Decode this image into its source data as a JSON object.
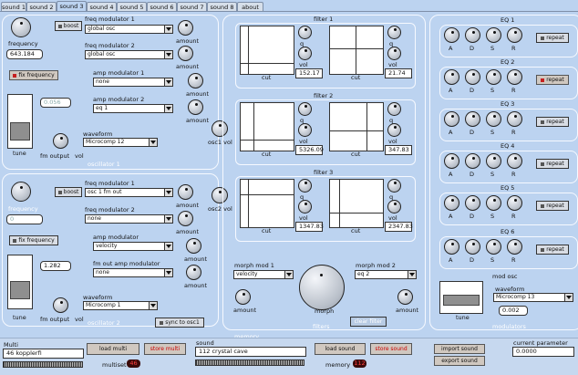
{
  "tabs": [
    "sound 1",
    "sound 2",
    "sound 3",
    "sound 4",
    "sound 5",
    "sound 6",
    "sound 7",
    "sound 8",
    "about"
  ],
  "osc1": {
    "frequency_label": "frequency",
    "frequency_value": "643.184",
    "boost": "boost",
    "fix_frequency": "fix frequency",
    "fix_value": "0.056",
    "freq_mod1_label": "freq modulator 1",
    "freq_mod1": "global osc",
    "freq_mod2_label": "freq modulator 2",
    "freq_mod2": "global osc",
    "amp_mod1_label": "amp modulator 1",
    "amp_mod1": "none",
    "amp_mod2_label": "amp modulator 2",
    "amp_mod2": "eq 1",
    "amount": "amount",
    "waveform_label": "waveform",
    "waveform": "Microcomp 12",
    "tune": "tune",
    "fm_output": "fm output",
    "vol": "vol",
    "panel": "oscillator 1"
  },
  "osc2": {
    "frequency_label": "frequency",
    "frequency_value": "0",
    "boost": "boost",
    "fix_frequency": "fix frequency",
    "fix_value": "1.282",
    "freq_mod1_label": "freq modulator 1",
    "freq_mod1": "osc 1 fm out",
    "freq_mod2_label": "freq modulator 2",
    "freq_mod2": "none",
    "amp_mod_label": "amp modulator",
    "amp_mod": "velocity",
    "fm_out_amp_mod_label": "fm out amp modulator",
    "fm_out_amp_mod": "none",
    "amount": "amount",
    "waveform_label": "waveform",
    "waveform": "Microcomp 1",
    "tune": "tune",
    "fm_output": "fm output",
    "vol": "vol",
    "sync": "sync to osc1",
    "panel": "oscillator 2"
  },
  "osc_vols": {
    "osc1_vol": "osc1 vol",
    "osc2_vol": "osc2 vol"
  },
  "filters": {
    "titles": [
      "filter 1",
      "filter 2",
      "filter 3"
    ],
    "q": "q",
    "vol": "vol",
    "cut": "cut",
    "values": [
      [
        "152.17",
        "21.74"
      ],
      [
        "5326.09",
        "347.83"
      ],
      [
        "1347.83",
        "2347.83"
      ]
    ],
    "morph_mod1_label": "morph mod 1",
    "morph_mod1": "velocity",
    "morph_mod2_label": "morph mod 2",
    "morph_mod2": "eq 2",
    "amount": "amount",
    "morph": "morph",
    "clear": "clear filter",
    "panel": "filters"
  },
  "eqs": {
    "titles": [
      "EQ 1",
      "EQ 2",
      "EQ 3",
      "EQ 4",
      "EQ 5",
      "EQ 6"
    ],
    "adsr": [
      "A",
      "D",
      "S",
      "R"
    ],
    "repeat": "repeat",
    "repeat_on": [
      false,
      true,
      false,
      false,
      false,
      false
    ]
  },
  "mod_osc": {
    "title": "mod osc",
    "waveform_label": "waveform",
    "waveform": "Microcomp 13",
    "tune": "tune",
    "value": "0.002",
    "panel": "modulators"
  },
  "memory_label": "memory",
  "bottom": {
    "multi_label": "Multi",
    "multi_value": "46 kopplerfi",
    "load_multi": "load multi",
    "store_multi": "store multi",
    "multiset_label": "multiset",
    "multiset_value": "46",
    "sound_label": "sound",
    "sound_value": "112 crystal cave",
    "load_sound": "load sound",
    "store_sound": "store sound",
    "memory_label": "memory",
    "memory_value": "112",
    "import_sound": "import sound",
    "export_sound": "export sound",
    "current_param_label": "current parameter",
    "current_param_value": "0.0000"
  }
}
